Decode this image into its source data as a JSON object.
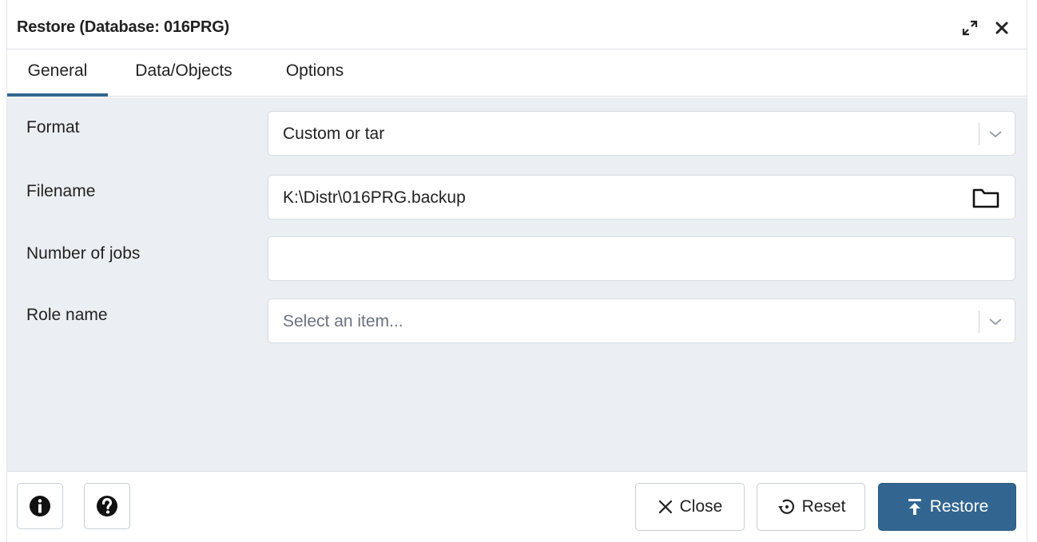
{
  "dialog": {
    "title": "Restore (Database: 016PRG)"
  },
  "tabs": [
    {
      "label": "General",
      "active": true
    },
    {
      "label": "Data/Objects",
      "active": false
    },
    {
      "label": "Options",
      "active": false
    }
  ],
  "form": {
    "format": {
      "label": "Format",
      "value": "Custom or tar"
    },
    "filename": {
      "label": "Filename",
      "value": "K:\\Distr\\016PRG.backup"
    },
    "jobs": {
      "label": "Number of jobs",
      "value": ""
    },
    "role": {
      "label": "Role name",
      "placeholder": "Select an item..."
    }
  },
  "footer": {
    "close_label": "Close",
    "reset_label": "Reset",
    "restore_label": "Restore"
  },
  "icons": {
    "expand": "expand-icon",
    "close": "close-icon",
    "chevron": "chevron-down-icon",
    "folder": "folder-icon",
    "info": "info-icon",
    "help": "help-icon",
    "reset": "reset-icon",
    "restore": "upload-icon"
  },
  "colors": {
    "primary": "#326690",
    "body_bg": "#ebeef3"
  }
}
